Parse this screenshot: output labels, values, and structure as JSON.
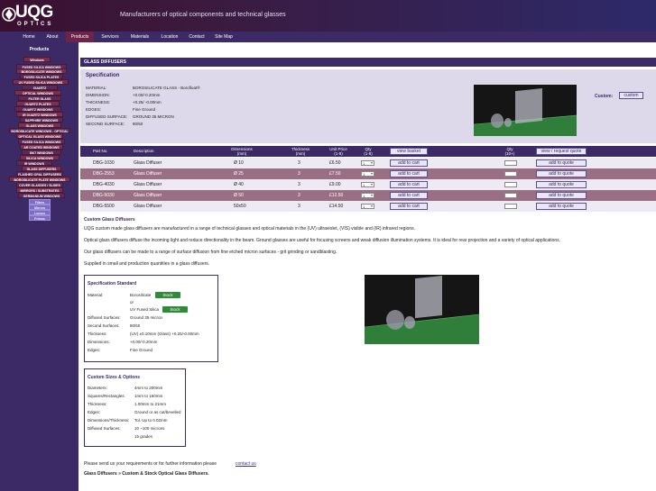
{
  "header": {
    "logo_text": "UQG",
    "logo_sub": "OPTICS",
    "tagline": "Manufacturers of optical components and technical glasses"
  },
  "nav": [
    "Home",
    "About",
    "Products",
    "Services",
    "Materials",
    "Location",
    "Contact",
    "Site Map"
  ],
  "sidebar": {
    "title": "Products",
    "items": [
      "Windows",
      "FUSED SILICA WINDOWS",
      "BOROSILICATE WINDOWS",
      "FUSED SILICA PLATES",
      "UV FUSED SILICA WINDOWS",
      "QUARTZ",
      "OPTICAL WINDOWS",
      "FILTER GLASS",
      "QUARTZ PLATES",
      "QUARTZ WINDOWS",
      "IR QUARTZ WINDOWS",
      "SAPPHIRE WINDOWS",
      "GLASS WINDOWS",
      "BOROSILICATE WINDOWS - OPTICAL",
      "OPTICAL GLASS WINDOWS",
      "FUSED SILICA WINDOWS",
      "AR COATED WINDOWS",
      "BK7 WINDOWS",
      "SILICA WINDOWS",
      "IR WINDOWS",
      "GLASS DIFFUSERS",
      "FLASHED OPAL DIFFUSERS",
      "BOROSILICATE PLATE WINDOWS",
      "COVER GLASSES / SLIDES",
      "MIRRORS / SUBSTRATES",
      "GERMANIUM WINDOWS",
      "Filters",
      "Mirrors",
      "Lenses",
      "Prisms"
    ]
  },
  "page": {
    "title": "GLASS DIFFUSERS"
  },
  "specification": {
    "heading": "Specification",
    "rows": [
      {
        "k": "MATERIAL:",
        "v": "BOROSILICATE GLASS - Borofloat®"
      },
      {
        "k": "DIMENSION:",
        "v": "+0.00/-0.20mm"
      },
      {
        "k": "THICKNESS:",
        "v": "+0.25/ -0.00mm"
      },
      {
        "k": "EDGES:",
        "v": "Fine Ground"
      },
      {
        "k": "DIFFUSED SURFACE:",
        "v": "GROUND 35 MICRON"
      },
      {
        "k": "SECOND SURFACE:",
        "v": "80/50"
      }
    ],
    "custom_label": "Custom:",
    "custom_button": "custom"
  },
  "table": {
    "headers": {
      "part": "Part No.",
      "desc": "Description",
      "dim": "Dimensions\n(mm)",
      "thick": "Thickness\n(mm)",
      "price": "Unit Price\n(1-9)",
      "qty": "Qty\n(1-9)",
      "basket": "view basket",
      "qty2": "Qty\n(10+)",
      "quote": "view / request quote"
    },
    "rows": [
      {
        "part": "DBG-1030",
        "desc": "Glass Diffuser",
        "dim": "Ø 10",
        "thick": "3",
        "price": "£6.50",
        "qty": "1",
        "cart": "add to cart",
        "quote": "add to quote"
      },
      {
        "part": "DBG-2553",
        "desc": "Glass Diffuser",
        "dim": "Ø 25",
        "thick": "3",
        "price": "£7.50",
        "qty": "1",
        "cart": "add to cart",
        "quote": "add to quote"
      },
      {
        "part": "DBG-4030",
        "desc": "Glass Diffuser",
        "dim": "Ø 40",
        "thick": "3",
        "price": "£9.00",
        "qty": "1",
        "cart": "add to cart",
        "quote": "add to quote"
      },
      {
        "part": "DBG-5030",
        "desc": "Glass Diffuser",
        "dim": "Ø 50",
        "thick": "3",
        "price": "£12.50",
        "qty": "1",
        "cart": "add to cart",
        "quote": "add to quote"
      },
      {
        "part": "DBG-5500",
        "desc": "Glass Diffuser",
        "dim": "50x50",
        "thick": "3",
        "price": "£14.50",
        "qty": "1",
        "cart": "add to cart",
        "quote": "add to quote"
      }
    ]
  },
  "custom": {
    "heading": "Custom Glass Diffusers",
    "p1": "UQG custom made glass diffusers are manufactured in a range of technical glasses and optical materials in the (UV) ultraviolet, (VIS) visible and (IR) infrared regions.",
    "p2": "Optical glass diffusers diffuse the incoming light and reduce directionality in the beam. Ground glasses are useful for focusing screens and weak diffusion illumination systems. It is ideal for rear projection and a variety of optical applications.",
    "p3": "Our glass diffusers can be made to a range of surface diffusion from fine etched micron surfaces - grit grinding or sandblasting.",
    "p4": "Supplied in small and production quantities in a glass diffusers."
  },
  "spec_standard": {
    "title": "Specification Standard",
    "material_label": "Material:",
    "mat1": "Borosilicate",
    "stock_btn": "Stock",
    "or": "or",
    "mat2": "UV Fused Silica",
    "rows": [
      {
        "k": "Diffused Surfaces:",
        "v": "Ground 35 micron"
      },
      {
        "k": "Second Surfaces:",
        "v": "80/50"
      },
      {
        "k": "Thickness:",
        "v": "(UV) ±0.10mm (Glass) +0.25/-0.00mm"
      },
      {
        "k": "Dimensions:",
        "v": "+0.00/-0.20mm"
      },
      {
        "k": "Edges:",
        "v": "Fine Ground"
      }
    ]
  },
  "custom_sizes": {
    "title": "Custom Sizes & Options",
    "rows": [
      {
        "k": "Diameters:",
        "v": "4mm to 200mm"
      },
      {
        "k": "Squares/Rectangles:",
        "v": "1mm to 160mm"
      },
      {
        "k": "Thickness:",
        "v": "1.00mm to 21mm"
      },
      {
        "k": "Edges:",
        "v": "Ground or as cut/bevelled"
      },
      {
        "k": "Dimensions/Thickness:",
        "v": "Tol. Up to 0.02mm"
      },
      {
        "k": "Diffused Surfaces:",
        "v": "10 ~100 microns"
      },
      {
        "k": "",
        "v": "15 grades"
      }
    ]
  },
  "footer": {
    "send": "Please send us your requirements or for further information please",
    "contact_link": "contact us",
    "tagline": "Glass Diffusers » Custom & Stock Optical Glass Diffusers."
  },
  "colors": {
    "brand": "#3b2a66",
    "accent": "#6e2348",
    "stock_green": "#2f8a3a"
  }
}
